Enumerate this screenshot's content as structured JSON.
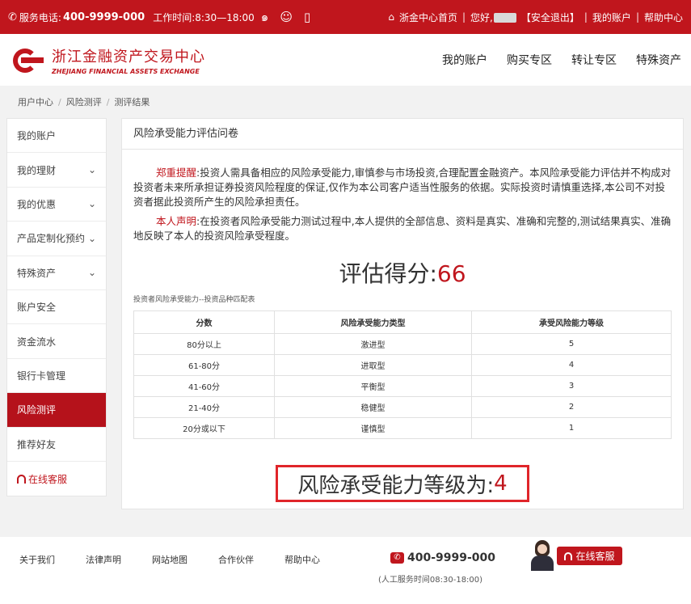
{
  "topbar": {
    "phone_label": "服务电话:",
    "phone_number": "400-9999-000",
    "work_hours": "工作时间:8:30—18:00",
    "home_link": "浙金中心首页",
    "greeting": "您好,",
    "logout": "【安全退出】",
    "my_account": "我的账户",
    "help_center": "帮助中心"
  },
  "header": {
    "logo_cn": "浙江金融资产交易中心",
    "logo_en": "ZHEJIANG FINANCIAL ASSETS EXCHANGE",
    "nav": [
      "我的账户",
      "购买专区",
      "转让专区",
      "特殊资产"
    ]
  },
  "breadcrumb": [
    "用户中心",
    "风险测评",
    "测评结果"
  ],
  "sidebar": {
    "items": [
      {
        "label": "我的账户",
        "chevron": false
      },
      {
        "label": "我的理财",
        "chevron": true
      },
      {
        "label": "我的优惠",
        "chevron": true
      },
      {
        "label": "产品定制化预约",
        "chevron": true
      },
      {
        "label": "特殊资产",
        "chevron": true
      },
      {
        "label": "账户安全",
        "chevron": false
      },
      {
        "label": "资金流水",
        "chevron": false
      },
      {
        "label": "银行卡管理",
        "chevron": false
      },
      {
        "label": "风险测评",
        "chevron": false
      },
      {
        "label": "推荐好友",
        "chevron": false
      }
    ],
    "service": "在线客服"
  },
  "main": {
    "title": "风险承受能力评估问卷",
    "notice_label": "郑重提醒",
    "notice_text": ":投资人需具备相应的风险承受能力,审慎参与市场投资,合理配置金融资产。本风险承受能力评估并不构成对投资者未来所承担证券投资风险程度的保证,仅作为本公司客户适当性服务的依据。实际投资时请慎重选择,本公司不对投资者据此投资所产生的风险承担责任。",
    "statement_label": "本人声明",
    "statement_text": ":在投资者风险承受能力测试过程中,本人提供的全部信息、资料是真实、准确和完整的,测试结果真实、准确地反映了本人的投资风险承受程度。",
    "score_label": "评估得分:",
    "score_value": "66",
    "table_caption": "投资者风险承受能力--投资品种匹配表",
    "table": {
      "headers": [
        "分数",
        "风险承受能力类型",
        "承受风险能力等级"
      ],
      "rows": [
        [
          "80分以上",
          "激进型",
          "5"
        ],
        [
          "61-80分",
          "进取型",
          "4"
        ],
        [
          "41-60分",
          "平衡型",
          "3"
        ],
        [
          "21-40分",
          "稳健型",
          "2"
        ],
        [
          "20分或以下",
          "谨慎型",
          "1"
        ]
      ]
    },
    "level_label": "风险承受能力等级为:",
    "level_value": "4"
  },
  "footer": {
    "links": [
      "关于我们",
      "法律声明",
      "网站地图",
      "合作伙伴",
      "帮助中心"
    ],
    "phone": "400-9999-000",
    "hours": "(人工服务时间08:30-18:00)",
    "service": "在线客服"
  },
  "colors": {
    "brand_red": "#c0161d",
    "highlight_border": "#e0252a"
  }
}
